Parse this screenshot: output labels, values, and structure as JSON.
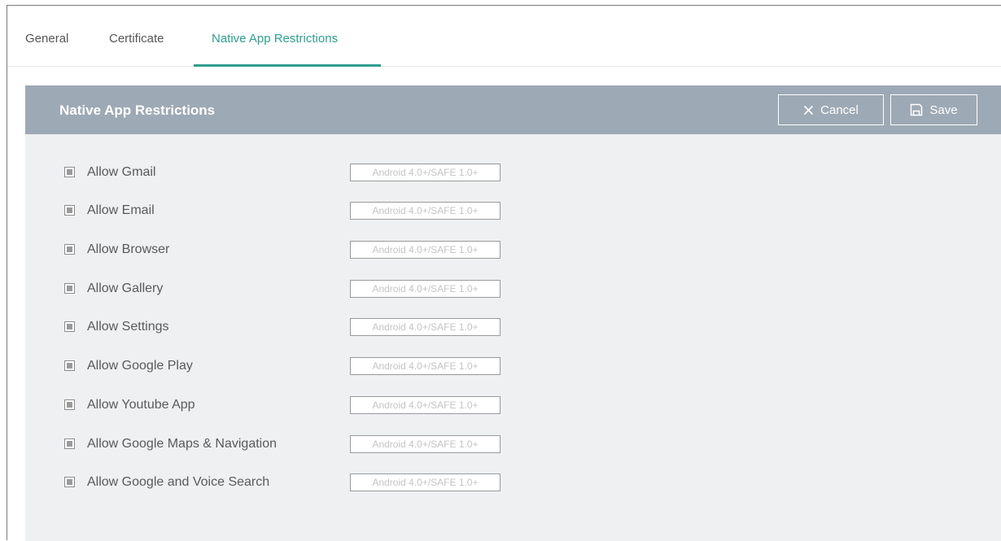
{
  "tabs": [
    {
      "label": "General",
      "active": false
    },
    {
      "label": "Certificate",
      "active": false
    },
    {
      "label": "Native App Restrictions",
      "active": true
    }
  ],
  "panel": {
    "title": "Native App Restrictions",
    "cancel_label": "Cancel",
    "save_label": "Save",
    "cancel_icon": "close-icon",
    "save_icon": "floppy-disk-icon"
  },
  "restrictions": [
    {
      "label": "Allow Gmail",
      "requirement": "Android 4.0+/SAFE 1.0+",
      "checked": false
    },
    {
      "label": "Allow Email",
      "requirement": "Android 4.0+/SAFE 1.0+",
      "checked": false
    },
    {
      "label": "Allow Browser",
      "requirement": "Android 4.0+/SAFE 1.0+",
      "checked": false
    },
    {
      "label": "Allow Gallery",
      "requirement": "Android 4.0+/SAFE 1.0+",
      "checked": false
    },
    {
      "label": "Allow Settings",
      "requirement": "Android 4.0+/SAFE 1.0+",
      "checked": false
    },
    {
      "label": "Allow Google Play",
      "requirement": "Android 4.0+/SAFE 1.0+",
      "checked": false
    },
    {
      "label": "Allow Youtube App",
      "requirement": "Android 4.0+/SAFE 1.0+",
      "checked": false
    },
    {
      "label": "Allow Google Maps & Navigation",
      "requirement": "Android 4.0+/SAFE 1.0+",
      "checked": false
    },
    {
      "label": "Allow Google and Voice Search",
      "requirement": "Android 4.0+/SAFE 1.0+",
      "checked": false
    }
  ],
  "colors": {
    "accent": "#2f9e8f",
    "header_bg": "#9da9b4",
    "panel_bg": "#eef0f2"
  }
}
